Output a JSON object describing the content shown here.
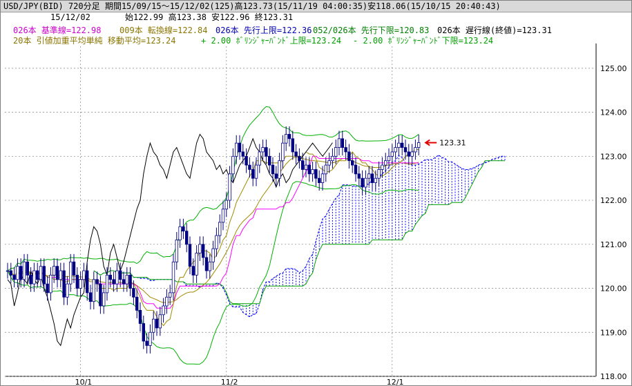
{
  "header": {
    "line1": "USD/JPY(BID) 720分足 期間15/09/15～15/12/02(125)高123.73(15/11/19 04:00:35)安118.06(15/10/15 20:40:43)",
    "line2_date": "15/12/02",
    "line2_ohlc": "始122.99 高123.38 安122.96 終123.31"
  },
  "legend": [
    {
      "text": "026本 基準線=122.98",
      "color": "#cc00cc"
    },
    {
      "text": "009本 転換線=122.84",
      "color": "#8b7500"
    },
    {
      "text": "026本 先行上限=122.36",
      "color": "#0000b0"
    },
    {
      "text": "052/026本 先行下限=120.83",
      "color": "#008000"
    },
    {
      "text": "026本 遅行線(終値)=123.31",
      "color": "#000000"
    },
    {
      "text": "20本 引値加重平均単純 移動平均=123.24",
      "color": "#8b7500"
    },
    {
      "text": "+ 2.00 ﾎﾞﾘﾝｼﾞｬｰﾊﾞﾝﾄﾞ上限=123.24",
      "color": "#00a000"
    },
    {
      "text": "- 2.00 ﾎﾞﾘﾝｼﾞｬｰﾊﾞﾝﾄﾞ下限=123.24",
      "color": "#00a000"
    }
  ],
  "last_price_marker": "123.31",
  "colors": {
    "candle": "#000080",
    "kijun": "#ff00ff",
    "tenkan": "#a08a00",
    "span_a": "#0000ff",
    "span_b": "#00a000",
    "chikou": "#000000",
    "bollinger": "#00b000",
    "arrow": "#e00000",
    "grid": "#808080"
  },
  "chart_data": {
    "type": "candlestick",
    "y_axis_ticks": [
      "125.00",
      "124.00",
      "123.00",
      "122.00",
      "121.00",
      "120.00",
      "119.00",
      "118.00"
    ],
    "ylim": [
      118.0,
      125.5
    ],
    "x_axis_ticks": [
      "10/1",
      "11/2",
      "12/1"
    ],
    "x_tick_index": [
      22,
      66,
      116
    ],
    "n_candles": 125,
    "price_high": 123.73,
    "price_low": 118.06,
    "last_close": 123.31,
    "closes": [
      120.4,
      120.3,
      120.2,
      120.5,
      120.2,
      120.6,
      120.3,
      120.1,
      120.4,
      120.2,
      120.5,
      120.1,
      119.9,
      120.3,
      120.5,
      120.2,
      120.4,
      119.8,
      120.1,
      120.6,
      120.3,
      120.0,
      120.2,
      120.4,
      119.9,
      119.7,
      120.2,
      120.1,
      119.6,
      119.9,
      120.3,
      120.2,
      120.1,
      120.4,
      120.2,
      120.1,
      120.3,
      120.0,
      119.8,
      119.5,
      119.2,
      118.8,
      118.7,
      119.0,
      119.3,
      119.1,
      119.4,
      119.6,
      119.8,
      119.9,
      120.6,
      121.1,
      121.4,
      121.3,
      121.0,
      120.5,
      120.3,
      120.8,
      121.0,
      120.7,
      120.4,
      120.6,
      120.9,
      121.2,
      121.5,
      121.8,
      122.0,
      122.6,
      123.0,
      123.3,
      123.1,
      123.0,
      122.8,
      122.7,
      122.5,
      122.8,
      123.1,
      123.2,
      123.0,
      122.8,
      122.6,
      122.5,
      122.9,
      123.3,
      123.5,
      123.4,
      123.1,
      123.0,
      122.9,
      122.7,
      122.8,
      122.6,
      122.7,
      122.5,
      122.4,
      122.6,
      122.8,
      122.9,
      123.0,
      123.2,
      123.4,
      123.2,
      123.1,
      122.9,
      122.8,
      122.6,
      122.5,
      122.3,
      122.5,
      122.6,
      122.4,
      122.5,
      122.7,
      122.8,
      122.9,
      123.0,
      123.1,
      123.2,
      123.3,
      123.2,
      123.1,
      123.0,
      123.1,
      123.2,
      123.31
    ]
  }
}
